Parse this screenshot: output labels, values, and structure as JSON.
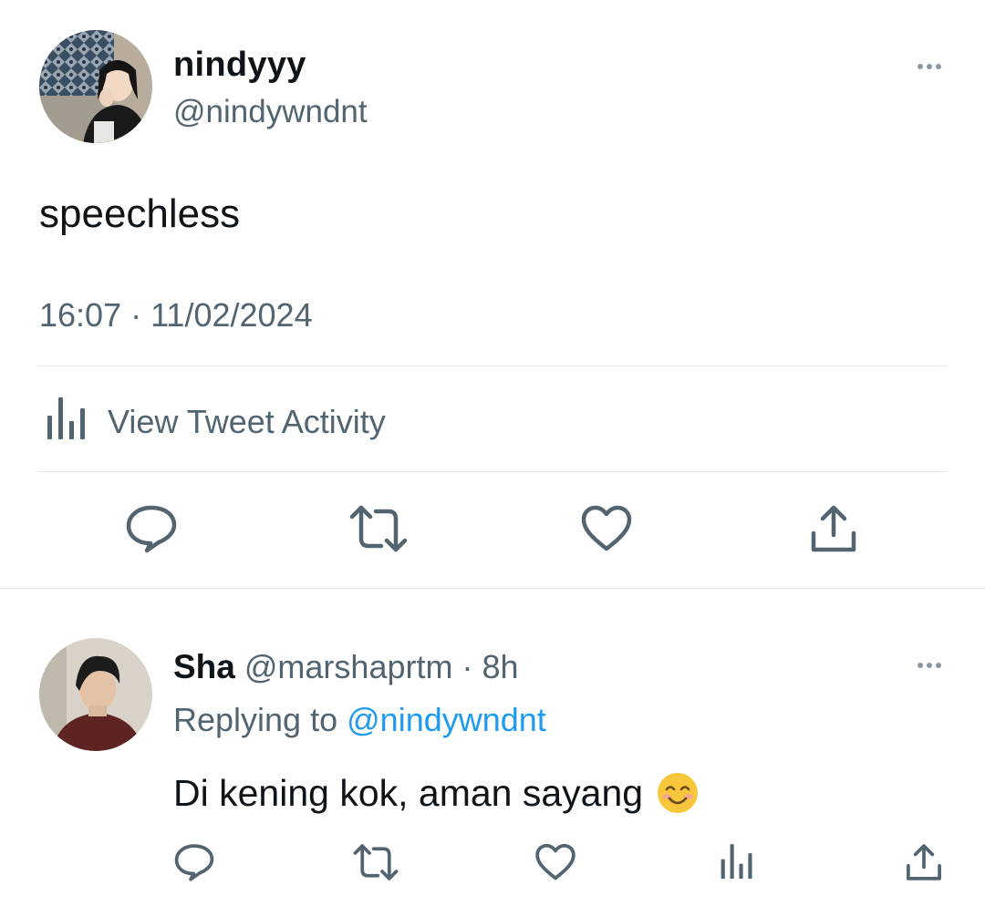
{
  "tweet": {
    "author_name": "nindyyy",
    "author_handle": "@nindywndnt",
    "text": "speechless",
    "timestamp": "16:07 · 11/02/2024",
    "activity_label": "View Tweet Activity"
  },
  "reply": {
    "author_name": "Sha",
    "meta": "@marshaprtm · 8h",
    "replying_to_label": "Replying to",
    "replying_to_handle": "@nindywndnt",
    "text": "Di kening kok, aman sayang",
    "emoji": "smiling-face-emoji"
  },
  "colors": {
    "text": "#0f1419",
    "secondary": "#536471",
    "accent": "#1d9bf0",
    "divider": "#e6e9eb"
  }
}
